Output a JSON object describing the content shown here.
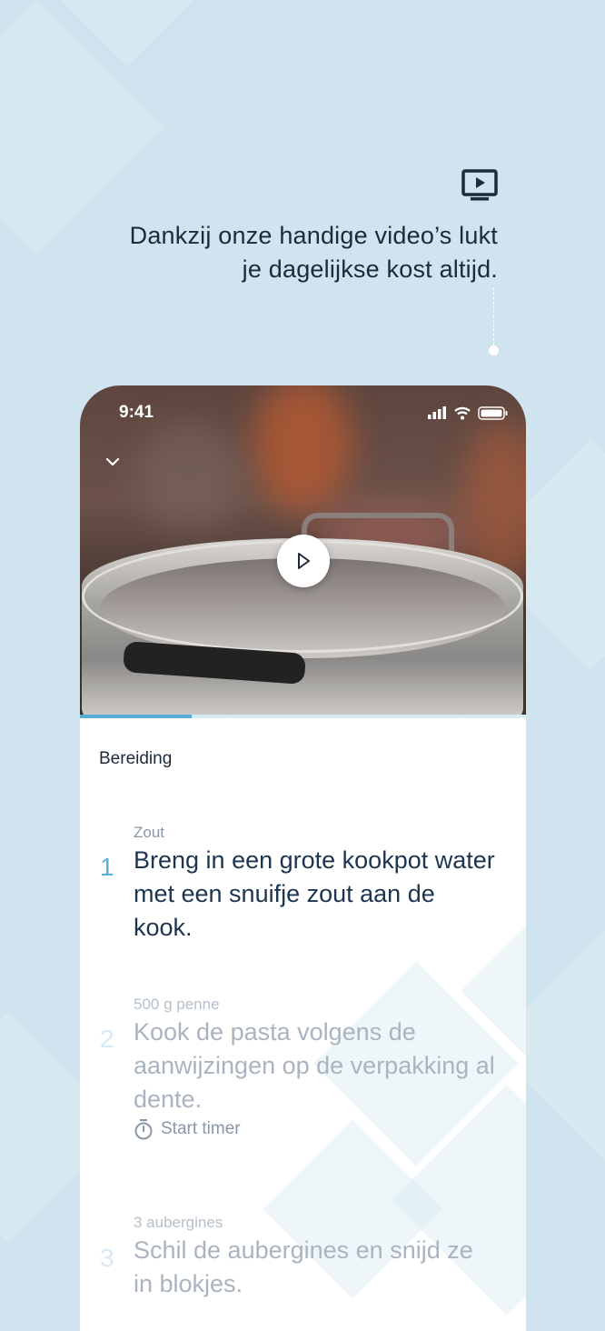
{
  "promo": {
    "icon": "tv-play-icon",
    "text": "Dankzij onze handige video’s lukt\nje dagelijkse kost altijd."
  },
  "status_bar": {
    "time": "9:41"
  },
  "video": {
    "progress": 0.25
  },
  "recipe": {
    "section_title": "Bereiding",
    "steps": [
      {
        "number": "1",
        "ingredient": "Zout",
        "text": "Breng in een grote kookpot water met een snuifje zout aan de kook."
      },
      {
        "number": "2",
        "ingredient": "500 g penne",
        "text": "Kook de pasta volgens de aanwijzingen op de verpakking al dente.",
        "timer_label": "Start timer"
      },
      {
        "number": "3",
        "ingredient": "3 aubergines",
        "text": "Schil de aubergines en snijd ze in blokjes."
      }
    ]
  },
  "colors": {
    "background": "#cfe4ee",
    "accent": "#5aaed6",
    "text_dark": "#1d3550"
  }
}
